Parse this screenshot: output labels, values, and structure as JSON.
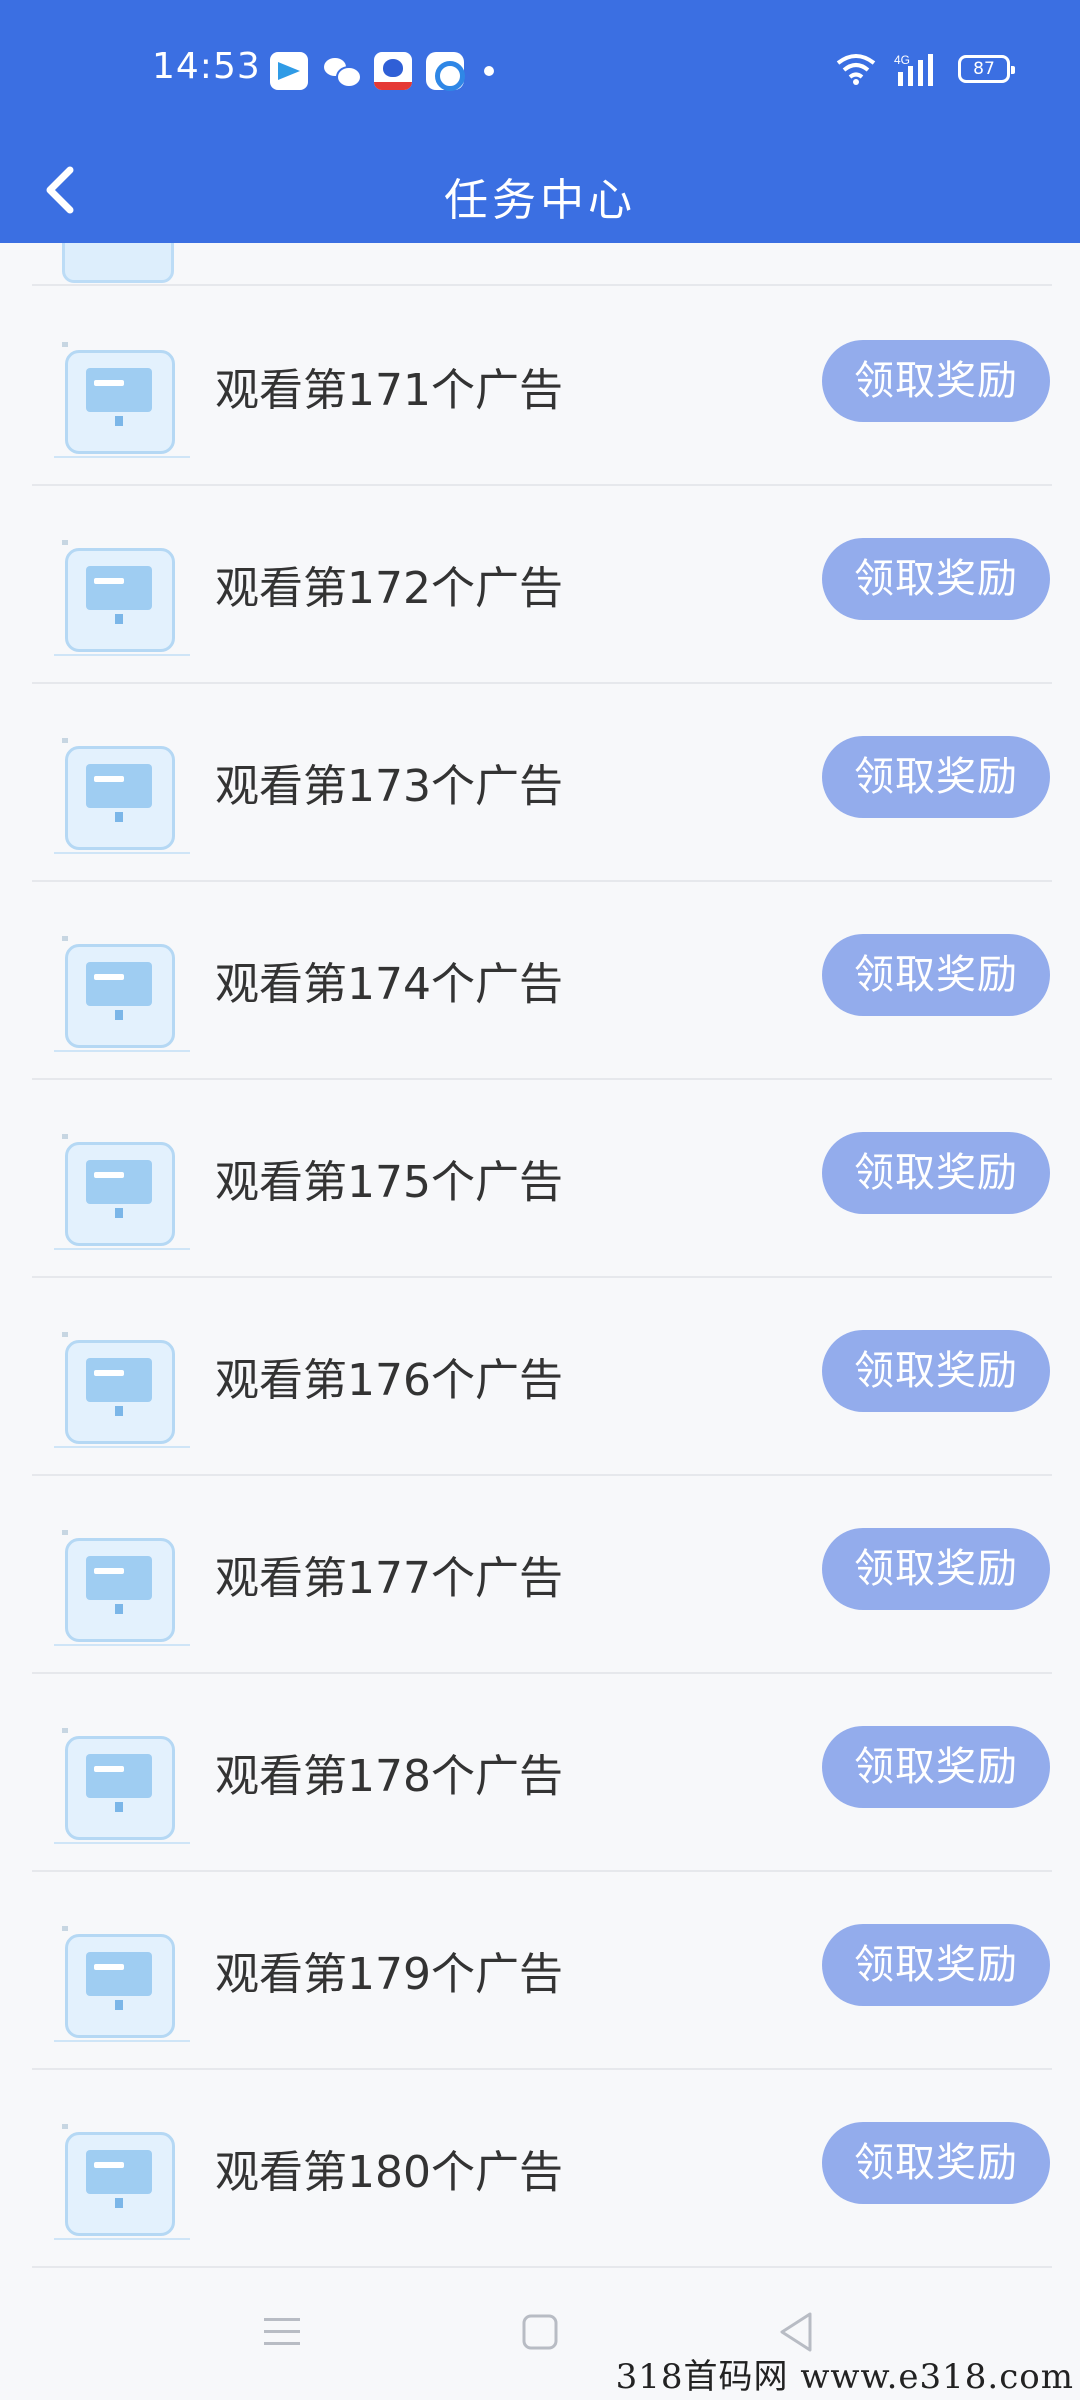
{
  "status_bar": {
    "time": "14:53",
    "notification_icons": [
      "telegram-icon",
      "wechat-icon",
      "baidu-icon",
      "circle-app-icon"
    ],
    "network": "4G",
    "battery": "87"
  },
  "header": {
    "back_icon": "chevron-left-icon",
    "title": "任务中心"
  },
  "colors": {
    "header": "#3b6fe2",
    "button": "#93acec",
    "background": "#f7f8fa"
  },
  "tasks": [
    {
      "label": "观看第171个广告",
      "button": "领取奖励"
    },
    {
      "label": "观看第172个广告",
      "button": "领取奖励"
    },
    {
      "label": "观看第173个广告",
      "button": "领取奖励"
    },
    {
      "label": "观看第174个广告",
      "button": "领取奖励"
    },
    {
      "label": "观看第175个广告",
      "button": "领取奖励"
    },
    {
      "label": "观看第176个广告",
      "button": "领取奖励"
    },
    {
      "label": "观看第177个广告",
      "button": "领取奖励"
    },
    {
      "label": "观看第178个广告",
      "button": "领取奖励"
    },
    {
      "label": "观看第179个广告",
      "button": "领取奖励"
    },
    {
      "label": "观看第180个广告",
      "button": "领取奖励"
    }
  ],
  "nav": {
    "icons": [
      "menu-icon",
      "home-square-icon",
      "back-triangle-icon"
    ]
  },
  "watermark": "318首码网 www.e318.com"
}
